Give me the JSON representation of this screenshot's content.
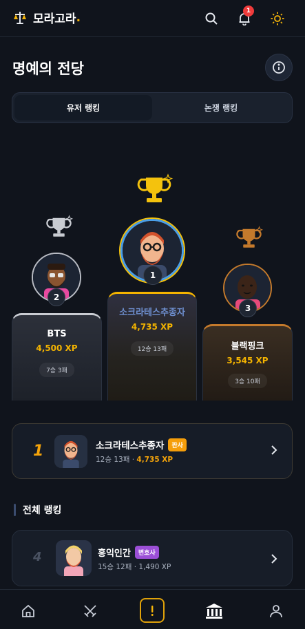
{
  "app": {
    "name": "모라고라",
    "name_dot": "."
  },
  "header": {
    "notification_count": "1"
  },
  "page": {
    "title": "명예의 전당"
  },
  "tabs": [
    {
      "label": "유저 랭킹",
      "active": true
    },
    {
      "label": "논쟁 랭킹",
      "active": false
    }
  ],
  "podium": {
    "first": {
      "rank": "1",
      "name": "소크라테스추종자",
      "xp": "4,735 XP",
      "record": "12승 13패"
    },
    "second": {
      "rank": "2",
      "name": "BTS",
      "xp": "4,500 XP",
      "record": "7승 3패"
    },
    "third": {
      "rank": "3",
      "name": "블랙핑크",
      "xp": "3,545 XP",
      "record": "3승 10패"
    }
  },
  "my_rank": {
    "rank": "1",
    "name": "소크라테스추종자",
    "tag": "판사",
    "tag_color": "#f59e0b",
    "record": "12승 13패 · ",
    "xp": "4,735 XP"
  },
  "section": {
    "title": "전체 랭킹"
  },
  "ranking_list": [
    {
      "rank": "4",
      "name": "홍익인간",
      "tag": "변호사",
      "tag_color": "#9b4fd6",
      "sub": "15승 12패 · 1,490 XP"
    }
  ],
  "colors": {
    "accent": "#f5b50a",
    "background": "#10141c",
    "gold": "#f4c20d",
    "silver": "#c9ccd2",
    "bronze": "#c47a2c"
  },
  "bottom_nav": [
    {
      "icon": "home-icon"
    },
    {
      "icon": "swords-icon"
    },
    {
      "icon": "exclamation-icon"
    },
    {
      "icon": "hall-of-fame-icon",
      "active": true
    },
    {
      "icon": "profile-icon"
    }
  ]
}
